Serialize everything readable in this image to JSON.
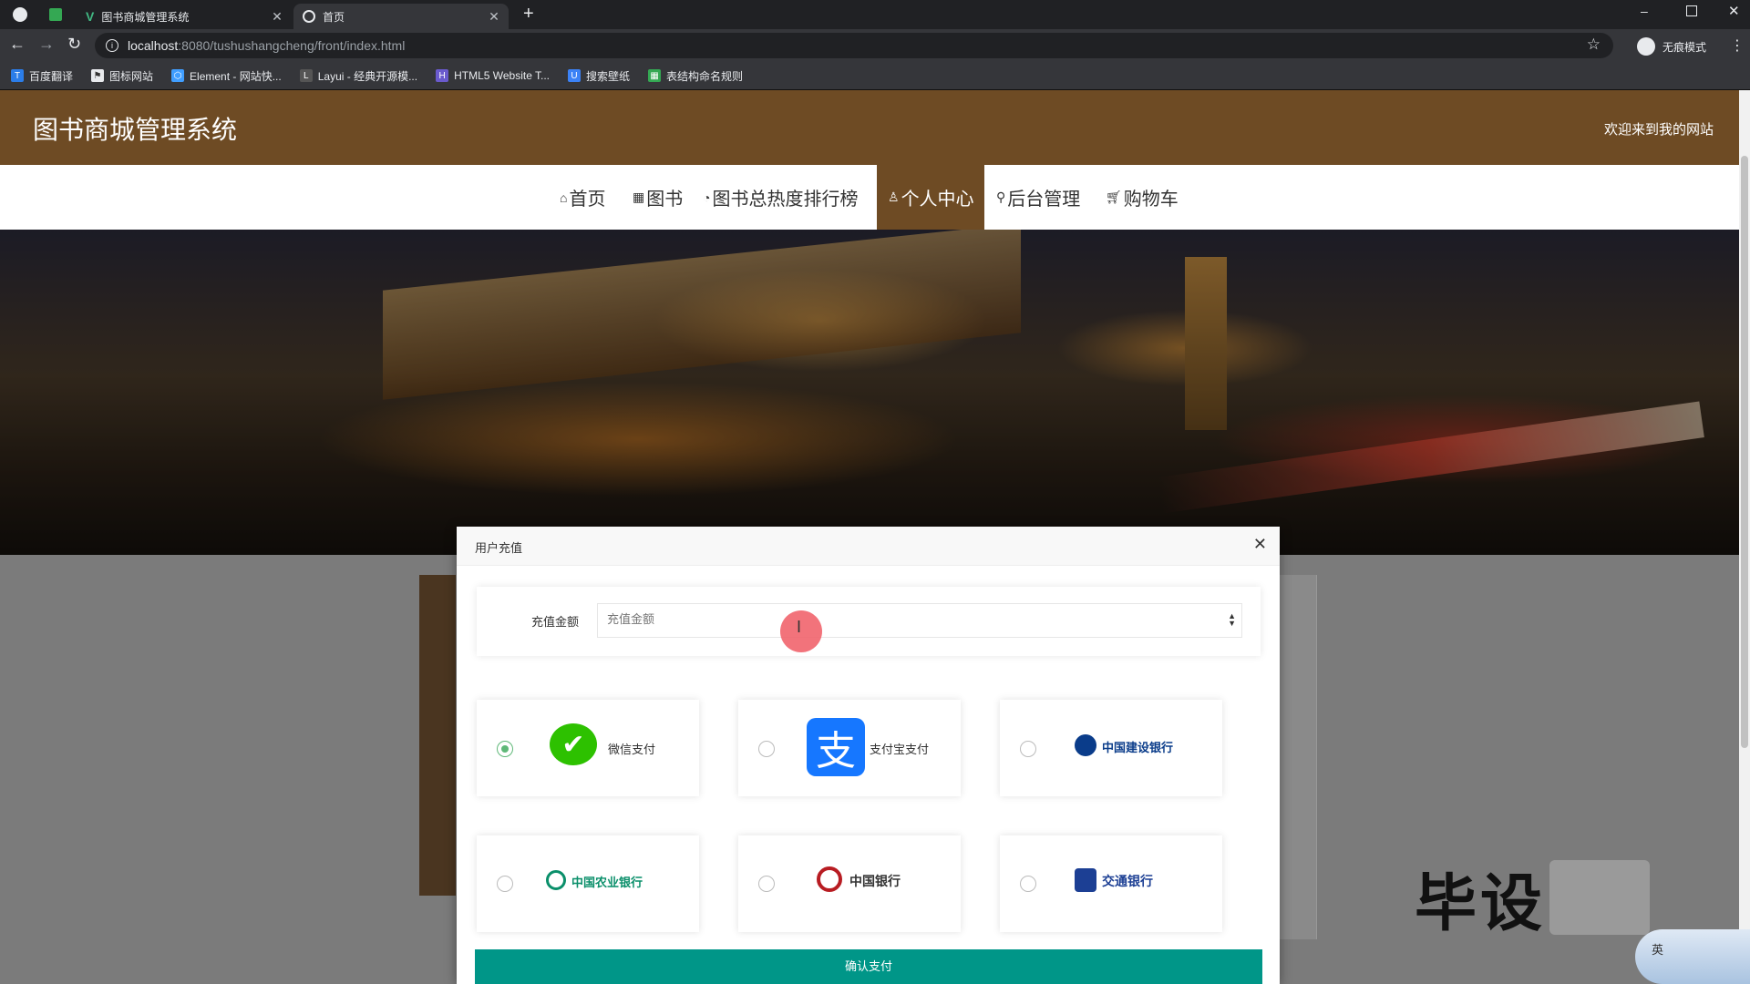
{
  "browser": {
    "tabs": [
      {
        "title": ""
      },
      {
        "title": "图书商城管理系统"
      },
      {
        "title": "首页"
      }
    ],
    "new_tab_symbol": "+",
    "url_host": "localhost",
    "url_rest": ":8080/tushushangcheng/front/index.html",
    "profile_label": "无痕模式",
    "bookmarks": [
      {
        "label": "百度翻译",
        "color": "#2b7de9"
      },
      {
        "label": "图标网站",
        "color": "#333333"
      },
      {
        "label": "Element - 网站快...",
        "color": "#409eff"
      },
      {
        "label": "Layui - 经典开源模...",
        "color": "#555555"
      },
      {
        "label": "HTML5 Website T...",
        "color": "#6a5acd"
      },
      {
        "label": "搜索壁纸",
        "color": "#3b82f6"
      },
      {
        "label": "表结构命名规则",
        "color": "#34a853"
      }
    ]
  },
  "site": {
    "title": "图书商城管理系统",
    "welcome": "欢迎来到我的网站",
    "nav": [
      {
        "label": "首页",
        "icon": "home-icon",
        "active": false
      },
      {
        "label": "图书",
        "icon": "grid-icon",
        "active": false
      },
      {
        "label": "图书总热度排行榜",
        "icon": "clock-icon",
        "active": false
      },
      {
        "label": "个人中心",
        "icon": "user-icon",
        "active": true
      },
      {
        "label": "后台管理",
        "icon": "link-icon",
        "active": false
      },
      {
        "label": "购物车",
        "icon": "cart-icon",
        "active": false
      }
    ],
    "colors": {
      "brand": "#6e4b24",
      "accent": "#5fb878",
      "confirm": "#009688"
    }
  },
  "modal": {
    "title": "用户充值",
    "amount_label": "充值金额",
    "amount_placeholder": "充值金额",
    "payment_options": [
      {
        "label": "微信支付",
        "logo": "wechat-pay-logo",
        "selected": true
      },
      {
        "label": "支付宝支付",
        "logo": "alipay-logo",
        "selected": false
      },
      {
        "label": "中国建设银行",
        "logo": "ccb-logo",
        "selected": false
      },
      {
        "label": "中国农业银行",
        "logo": "abc-logo",
        "selected": false
      },
      {
        "label": "中国银行",
        "logo": "boc-logo",
        "selected": false
      },
      {
        "label": "交通银行",
        "logo": "bocom-logo",
        "selected": false
      }
    ],
    "confirm_label": "确认支付"
  },
  "watermark": {
    "text": "毕设"
  },
  "ime": {
    "label": "英"
  }
}
